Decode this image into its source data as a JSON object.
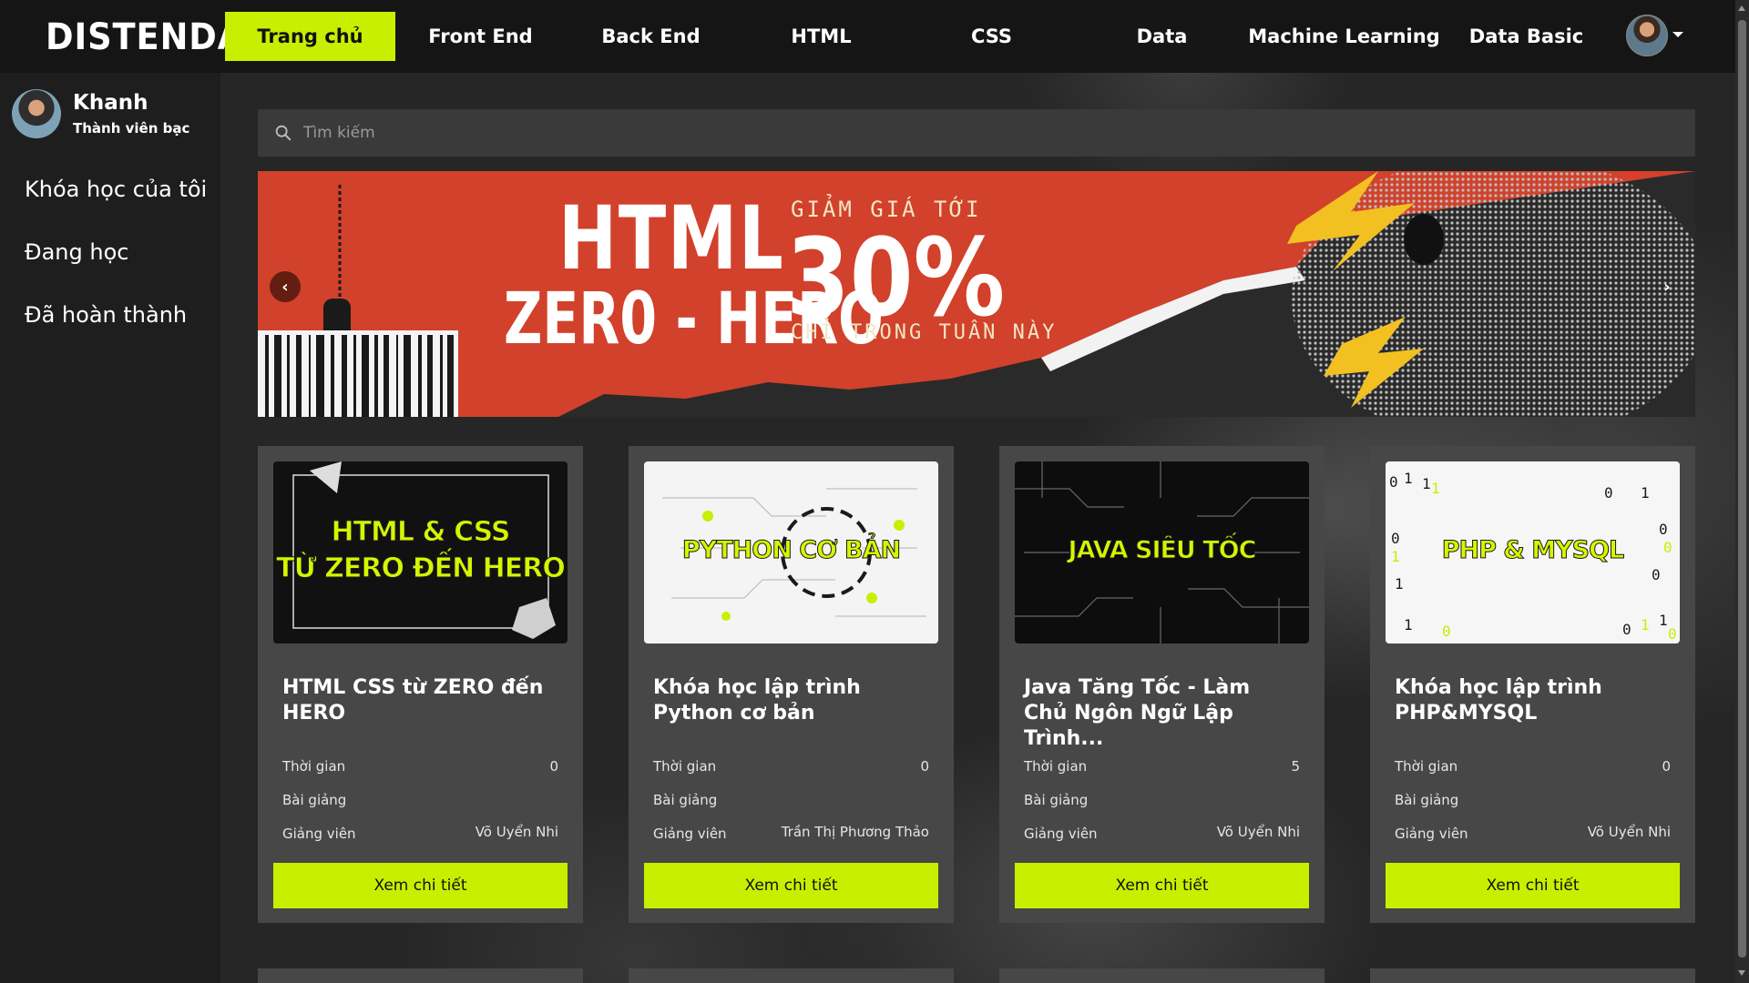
{
  "brand": {
    "logo": "DISTENDA",
    "accent": "#c8ef00"
  },
  "nav": {
    "items": [
      {
        "label": "Trang chủ",
        "active": true
      },
      {
        "label": "Front End",
        "active": false
      },
      {
        "label": "Back End",
        "active": false
      },
      {
        "label": "HTML",
        "active": false
      },
      {
        "label": "CSS",
        "active": false
      },
      {
        "label": "Data",
        "active": false
      },
      {
        "label": "Machine Learning",
        "active": false
      },
      {
        "label": "Data Basic",
        "active": false
      }
    ],
    "avatar_icon": "user-avatar",
    "dropdown_icon": "caret-down-icon"
  },
  "sidebar": {
    "user_name": "Khanh",
    "user_rank": "Thành viên bạc",
    "links": [
      {
        "label": "Khóa học của tôi"
      },
      {
        "label": "Đang học"
      },
      {
        "label": "Đã hoàn thành"
      }
    ]
  },
  "search": {
    "placeholder": "Tìm kiếm",
    "icon": "search-icon"
  },
  "banner": {
    "line1": "HTML",
    "line2": "ZER0 - HERO",
    "promo_top": "GIẢM GIÁ TỚI",
    "promo_value": "30%",
    "promo_bottom": "CHỈ TRONG TUẦN NÀY",
    "prev_icon": "chevron-left-icon",
    "next_icon": "chevron-right-icon"
  },
  "labels": {
    "time": "Thời gian",
    "lessons": "Bài giảng",
    "teacher": "Giảng viên",
    "detail_button": "Xem chi tiết"
  },
  "courses": [
    {
      "thumb_line1": "HTML & CSS",
      "thumb_line2": "TỪ ZERO ĐẾN HERO",
      "title": "HTML CSS từ ZERO đến HERO",
      "time": "0",
      "lessons": "",
      "teacher": "Võ Uyển Nhi"
    },
    {
      "thumb_line1": "PYTHON CƠ BẢN",
      "thumb_line2": "",
      "title": "Khóa học lập trình Python cơ bản",
      "time": "0",
      "lessons": "",
      "teacher": "Trần Thị Phương Thảo"
    },
    {
      "thumb_line1": "JAVA SIÊU TỐC",
      "thumb_line2": "",
      "title": "Java Tăng Tốc - Làm Chủ Ngôn Ngữ Lập Trình...",
      "time": "5",
      "lessons": "",
      "teacher": "Võ Uyển Nhi"
    },
    {
      "thumb_line1": "PHP & MYSQL",
      "thumb_line2": "",
      "title": "Khóa học lập trình PHP&MYSQL",
      "time": "0",
      "lessons": "",
      "teacher": "Võ Uyển Nhi"
    }
  ]
}
